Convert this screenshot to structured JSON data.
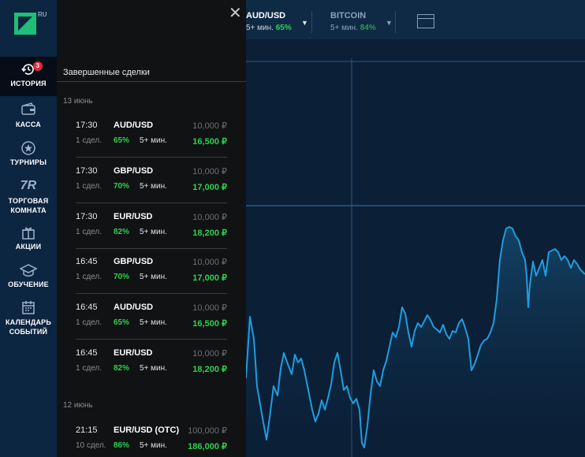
{
  "logo": {
    "suffix": "RU"
  },
  "sidebar": {
    "items": [
      {
        "label": "ИСТОРИЯ",
        "icon": "history-icon",
        "badge": "3"
      },
      {
        "label": "КАССА",
        "icon": "wallet-icon"
      },
      {
        "label": "ТУРНИРЫ",
        "icon": "star-icon"
      },
      {
        "label_line1": "ТОРГОВАЯ",
        "label_line2": "КОМНАТА",
        "icon": "trading-room-icon",
        "icon_text": "7R"
      },
      {
        "label": "АКЦИИ",
        "icon": "gift-icon"
      },
      {
        "label": "ОБУЧЕНИЕ",
        "icon": "graduation-cap-icon"
      },
      {
        "label_line1": "КАЛЕНДАРЬ",
        "label_line2": "СОБЫТИЙ",
        "icon": "calendar-icon"
      }
    ]
  },
  "panel": {
    "title": "Завершенные сделки",
    "groups": [
      {
        "date": "13 июнь",
        "deals": [
          {
            "time": "17:30",
            "pair": "AUD/USD",
            "amount": "10,000 ₽",
            "count": "1 сдел.",
            "percent": "65%",
            "duration": "5+ мин.",
            "payout": "16,500 ₽"
          },
          {
            "time": "17:30",
            "pair": "GBP/USD",
            "amount": "10,000 ₽",
            "count": "1 сдел.",
            "percent": "70%",
            "duration": "5+ мин.",
            "payout": "17,000 ₽"
          },
          {
            "time": "17:30",
            "pair": "EUR/USD",
            "amount": "10,000 ₽",
            "count": "1 сдел.",
            "percent": "82%",
            "duration": "5+ мин.",
            "payout": "18,200 ₽"
          },
          {
            "time": "16:45",
            "pair": "GBP/USD",
            "amount": "10,000 ₽",
            "count": "1 сдел.",
            "percent": "70%",
            "duration": "5+ мин.",
            "payout": "17,000 ₽"
          },
          {
            "time": "16:45",
            "pair": "AUD/USD",
            "amount": "10,000 ₽",
            "count": "1 сдел.",
            "percent": "65%",
            "duration": "5+ мин.",
            "payout": "16,500 ₽"
          },
          {
            "time": "16:45",
            "pair": "EUR/USD",
            "amount": "10,000 ₽",
            "count": "1 сдел.",
            "percent": "82%",
            "duration": "5+ мин.",
            "payout": "18,200 ₽"
          }
        ]
      },
      {
        "date": "12 июнь",
        "deals": [
          {
            "time": "21:15",
            "pair": "EUR/USD (OTC)",
            "amount": "100,000 ₽",
            "count": "10 сдел.",
            "percent": "86%",
            "duration": "5+ мин.",
            "payout": "186,000 ₽"
          }
        ]
      }
    ]
  },
  "topbar": {
    "assets": [
      {
        "name": "AUD/USD",
        "duration": "5+ мин.",
        "percent": "65%"
      },
      {
        "name": "BITCOIN",
        "duration": "5+ мин.",
        "percent": "84%"
      }
    ]
  },
  "colors": {
    "accent_green": "#2dd24b",
    "chart_line": "#1e9de0",
    "badge_red": "#e0293b",
    "logo_green": "#1fbf75"
  }
}
